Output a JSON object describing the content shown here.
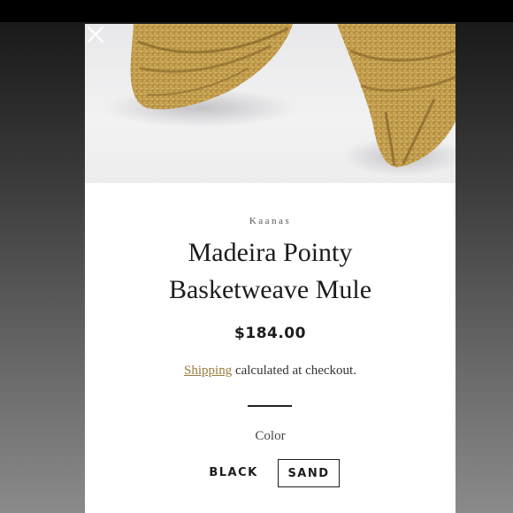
{
  "product": {
    "brand": "Kaanas",
    "title_line1": "Madeira Pointy",
    "title_line2": "Basketweave Mule",
    "price": "$184.00",
    "shipping_link": "Shipping",
    "shipping_text": " calculated at checkout."
  },
  "options": {
    "color_label": "Color",
    "colors": [
      "BLACK",
      "SAND"
    ],
    "selected": "SAND"
  },
  "colors": {
    "link": "#9a7a3a",
    "text": "#1c1c1c",
    "straw": "#c9a552"
  },
  "icons": {
    "close": "close-icon"
  }
}
